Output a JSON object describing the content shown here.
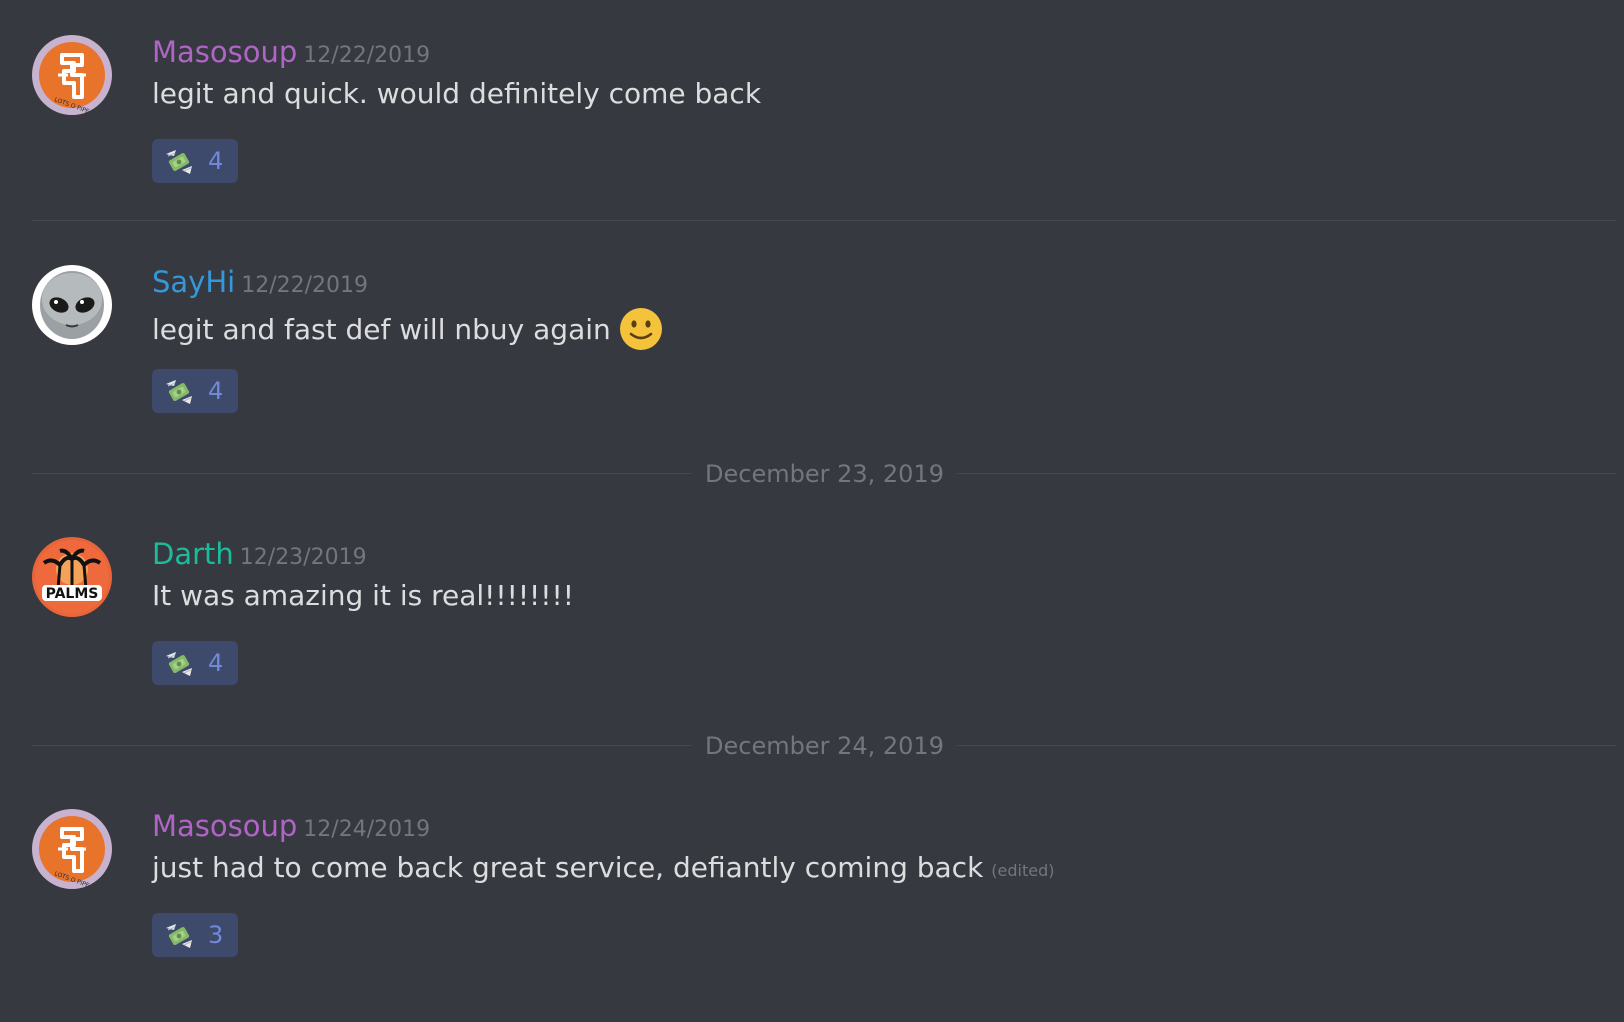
{
  "messages": [
    {
      "author": "Masosoup",
      "author_color": "#b065c6",
      "timestamp": "12/22/2019",
      "text": "legit and quick. would definitely come back",
      "avatar": "lots-o-pipe-avatar",
      "reaction": {
        "emoji": "money-with-wings-icon",
        "count": "4"
      }
    },
    {
      "author": "SayHi",
      "author_color": "#3498db",
      "timestamp": "12/22/2019",
      "text": "legit and fast def will nbuy again",
      "trailing_emoji": "slightly-smiling-face-icon",
      "avatar": "alien-avatar",
      "reaction": {
        "emoji": "money-with-wings-icon",
        "count": "4"
      }
    },
    {
      "author": "Darth",
      "author_color": "#1abc9c",
      "timestamp": "12/23/2019",
      "text": "It was amazing it is real!!!!!!!!",
      "avatar": "palms-avatar",
      "reaction": {
        "emoji": "money-with-wings-icon",
        "count": "4"
      }
    },
    {
      "author": "Masosoup",
      "author_color": "#b065c6",
      "timestamp": "12/24/2019",
      "text": "just had to come back great service, defiantly coming back",
      "edited_label": "(edited)",
      "avatar": "lots-o-pipe-avatar",
      "reaction": {
        "emoji": "money-with-wings-icon",
        "count": "3"
      }
    }
  ],
  "date_dividers": [
    "December 23, 2019",
    "December 24, 2019"
  ],
  "colors": {
    "background": "#36393f",
    "message_text": "#dcddde",
    "muted_text": "#72767d",
    "reaction_bg": "#3e4a6b",
    "reaction_count": "#7289da"
  }
}
